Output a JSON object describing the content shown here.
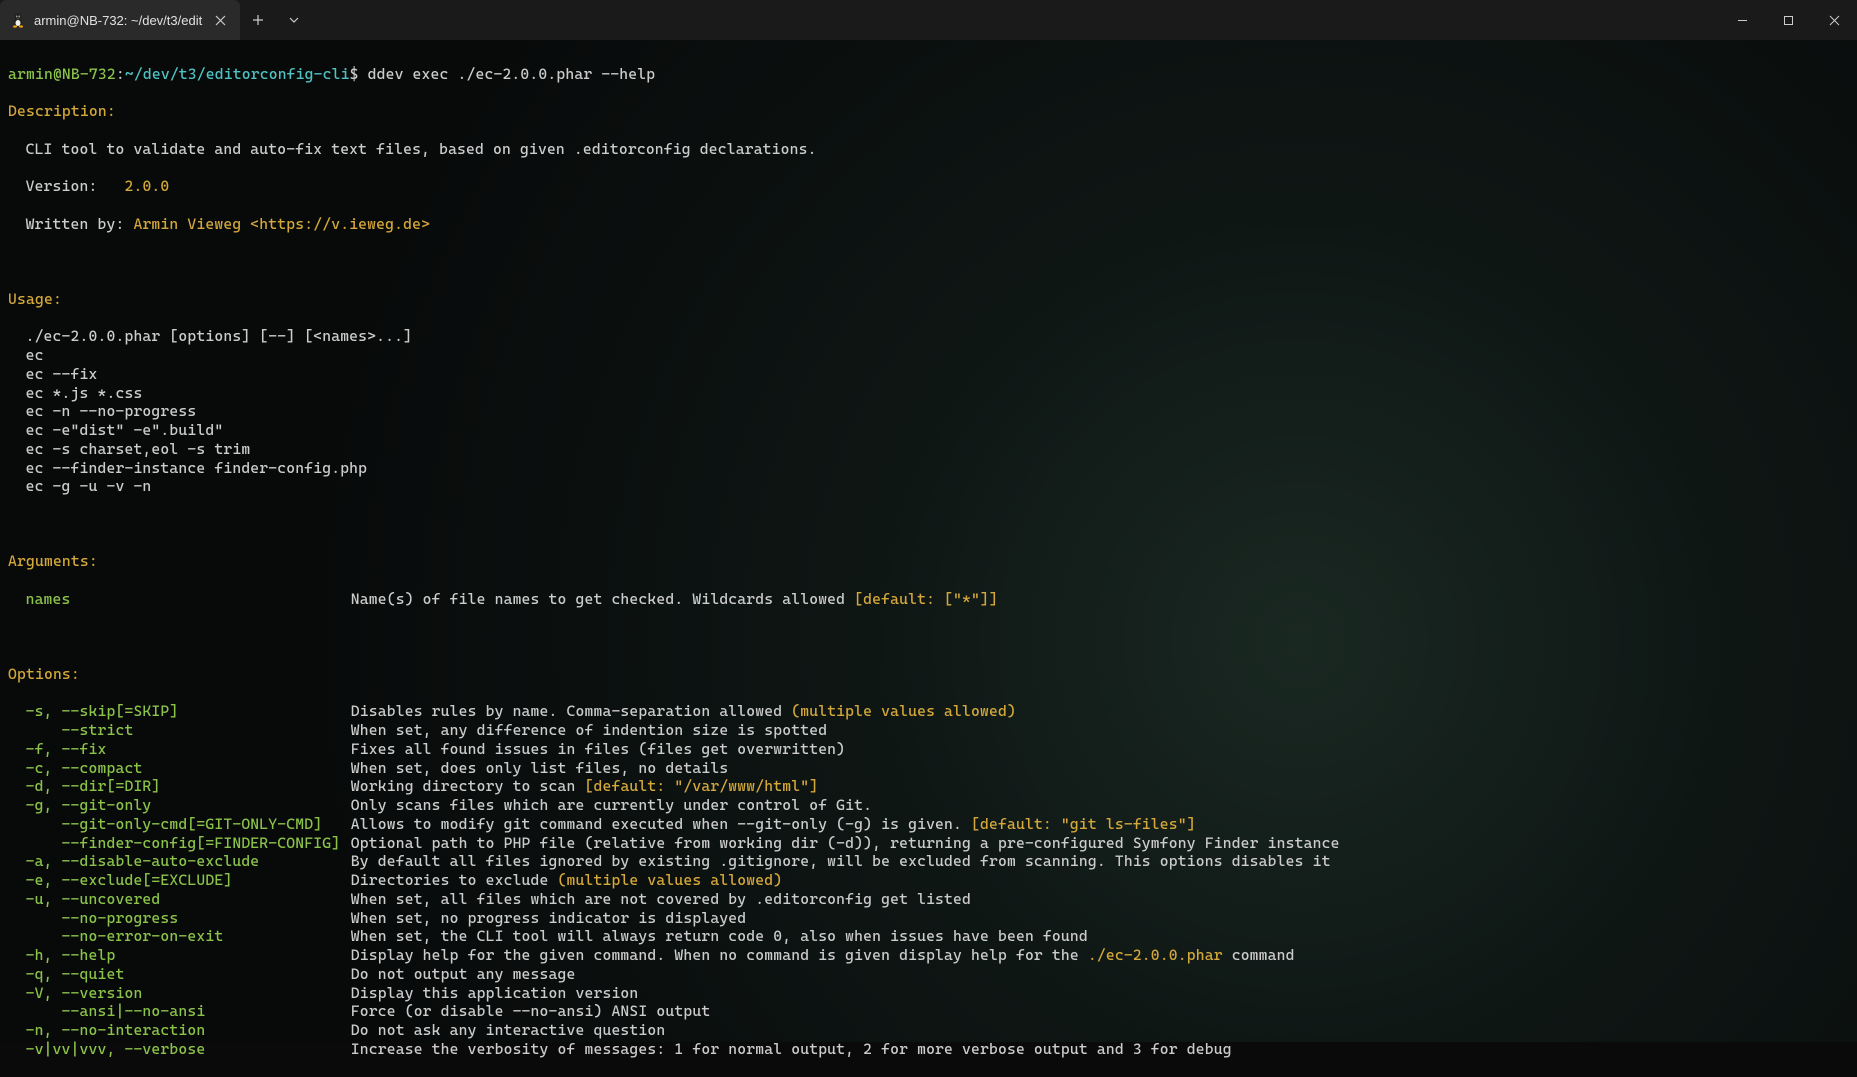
{
  "titlebar": {
    "tab_title": "armin@NB-732: ~/dev/t3/edit",
    "plus": "+",
    "chevron": "⌄"
  },
  "prompt": {
    "user_host": "armin@NB-732",
    "colon": ":",
    "path": "~/dev/t3/editorconfig-cli",
    "dollar": "$",
    "command": "ddev exec ./ec-2.0.0.phar --help"
  },
  "description": {
    "header": "Description:",
    "line1": "CLI tool to validate and auto-fix text files, based on given .editorconfig declarations.",
    "version_label": "Version:   ",
    "version": "2.0.0",
    "written_label": "Written by: ",
    "author": "Armin Vieweg <https://v.ieweg.de>"
  },
  "usage": {
    "header": "Usage:",
    "lines": [
      "./ec-2.0.0.phar [options] [--] [<names>...]",
      "ec",
      "ec --fix",
      "ec *.js *.css",
      "ec -n --no-progress",
      "ec -e\"dist\" -e\".build\"",
      "ec -s charset,eol -s trim",
      "ec --finder-instance finder-config.php",
      "ec -g -u -v -n"
    ]
  },
  "arguments": {
    "header": "Arguments:",
    "name_flag": "names",
    "name_desc": "Name(s) of file names to get checked. Wildcards allowed ",
    "name_default": "[default: [\"*\"]]"
  },
  "options": {
    "header": "Options:",
    "rows": [
      {
        "flag": "-s, --skip[=SKIP]",
        "desc": "Disables rules by name. Comma-separation allowed ",
        "tail_yellow": "(multiple values allowed)"
      },
      {
        "flag": "    --strict",
        "desc": "When set, any difference of indention size is spotted"
      },
      {
        "flag": "-f, --fix",
        "desc": "Fixes all found issues in files (files get overwritten)"
      },
      {
        "flag": "-c, --compact",
        "desc": "When set, does only list files, no details"
      },
      {
        "flag": "-d, --dir[=DIR]",
        "desc": "Working directory to scan ",
        "tail_yellow": "[default: \"/var/www/html\"]"
      },
      {
        "flag": "-g, --git-only",
        "desc": "Only scans files which are currently under control of Git."
      },
      {
        "flag": "    --git-only-cmd[=GIT-ONLY-CMD]",
        "desc": "Allows to modify git command executed when --git-only (-g) is given. ",
        "tail_yellow": "[default: \"git ls-files\"]"
      },
      {
        "flag": "    --finder-config[=FINDER-CONFIG]",
        "desc": "Optional path to PHP file (relative from working dir (-d)), returning a pre-configured Symfony Finder instance"
      },
      {
        "flag": "-a, --disable-auto-exclude",
        "desc": "By default all files ignored by existing .gitignore, will be excluded from scanning. This options disables it"
      },
      {
        "flag": "-e, --exclude[=EXCLUDE]",
        "desc": "Directories to exclude ",
        "tail_yellow": "(multiple values allowed)"
      },
      {
        "flag": "-u, --uncovered",
        "desc": "When set, all files which are not covered by .editorconfig get listed"
      },
      {
        "flag": "    --no-progress",
        "desc": "When set, no progress indicator is displayed"
      },
      {
        "flag": "    --no-error-on-exit",
        "desc": "When set, the CLI tool will always return code 0, also when issues have been found"
      },
      {
        "flag": "-h, --help",
        "desc": "Display help for the given command. When no command is given display help for the ",
        "tail_yellow": "./ec-2.0.0.phar",
        "after": " command"
      },
      {
        "flag": "-q, --quiet",
        "desc": "Do not output any message"
      },
      {
        "flag": "-V, --version",
        "desc": "Display this application version"
      },
      {
        "flag": "    --ansi|--no-ansi",
        "desc": "Force (or disable --no-ansi) ANSI output"
      },
      {
        "flag": "-n, --no-interaction",
        "desc": "Do not ask any interactive question"
      },
      {
        "flag": "-v|vv|vvv, --verbose",
        "desc": "Increase the verbosity of messages: 1 for normal output, 2 for more verbose output and 3 for debug"
      }
    ]
  }
}
